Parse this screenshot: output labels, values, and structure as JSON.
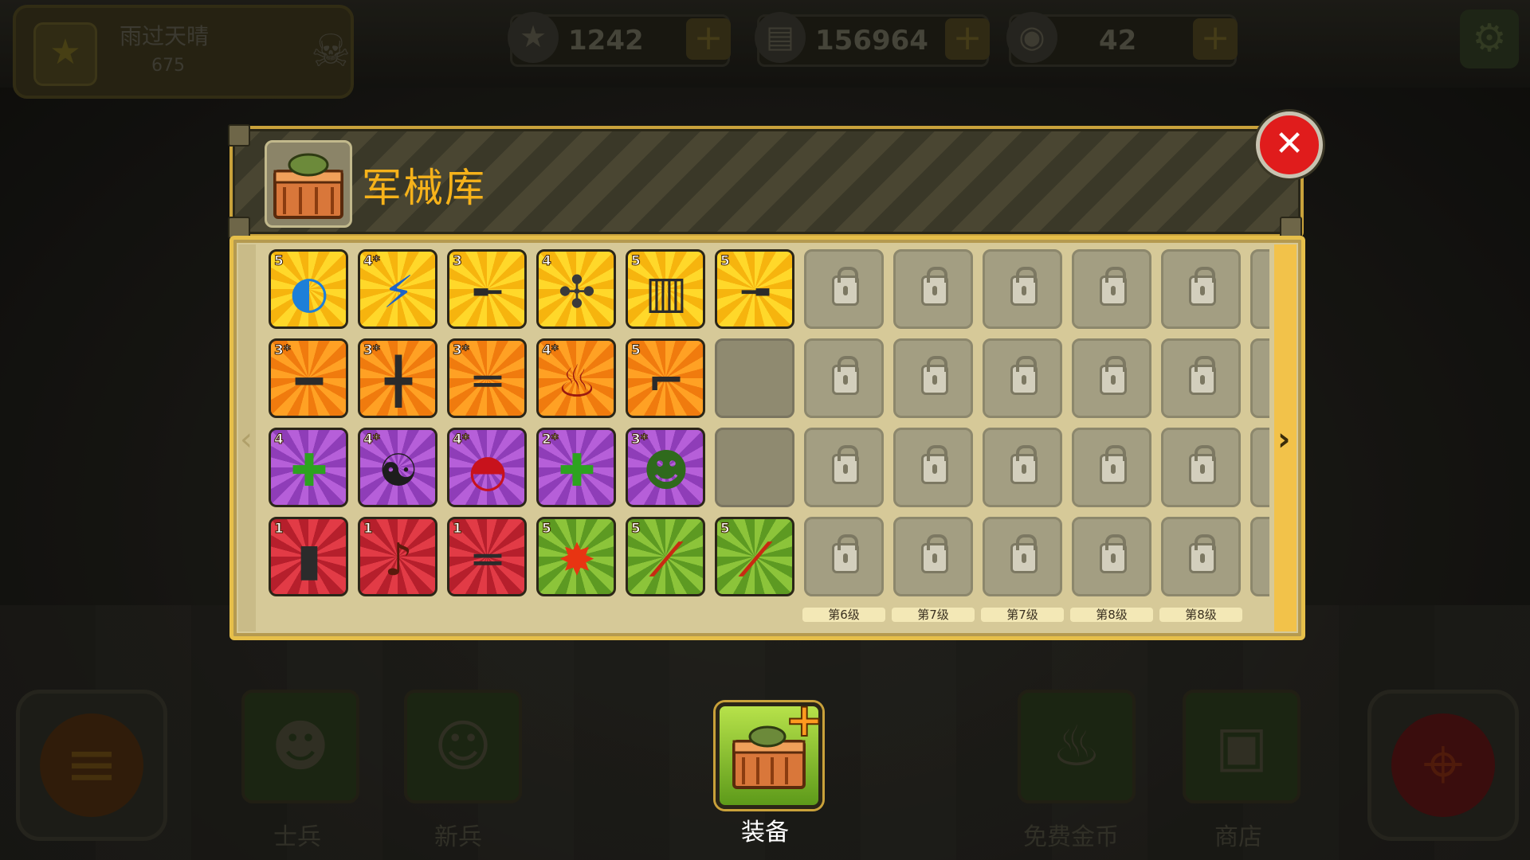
{
  "player": {
    "name": "雨过天晴",
    "medals": "675"
  },
  "resources": [
    {
      "name": "stars",
      "icon": "star-icon",
      "value": "1242"
    },
    {
      "name": "cash",
      "icon": "cash-icon",
      "value": "156964"
    },
    {
      "name": "coins",
      "icon": "coin-icon",
      "value": "42"
    }
  ],
  "armory": {
    "title": "军械库"
  },
  "items": [
    {
      "row": 0,
      "col": 0,
      "level": "5",
      "bg": "yellow",
      "icon": "shield-soldier-icon"
    },
    {
      "row": 0,
      "col": 1,
      "level": "4*",
      "bg": "yellow",
      "icon": "blue-lightning-gun-icon"
    },
    {
      "row": 0,
      "col": 2,
      "level": "3",
      "bg": "yellow",
      "icon": "rifle-icon"
    },
    {
      "row": 0,
      "col": 3,
      "level": "4",
      "bg": "yellow",
      "icon": "drone-icon"
    },
    {
      "row": 0,
      "col": 4,
      "level": "5",
      "bg": "yellow",
      "icon": "gatling-icon"
    },
    {
      "row": 0,
      "col": 5,
      "level": "5",
      "bg": "yellow",
      "icon": "assault-rifle-icon"
    },
    {
      "row": 1,
      "col": 0,
      "level": "3*",
      "bg": "orange",
      "icon": "sniper-rifle-icon"
    },
    {
      "row": 1,
      "col": 1,
      "level": "3*",
      "bg": "orange",
      "icon": "machine-gun-icon"
    },
    {
      "row": 1,
      "col": 2,
      "level": "3*",
      "bg": "orange",
      "icon": "shotgun-icon"
    },
    {
      "row": 1,
      "col": 3,
      "level": "4*",
      "bg": "orange",
      "icon": "molotov-icon"
    },
    {
      "row": 1,
      "col": 4,
      "level": "5",
      "bg": "orange",
      "icon": "flare-pistol-icon"
    },
    {
      "row": 2,
      "col": 0,
      "level": "4",
      "bg": "purple",
      "icon": "green-flame-plus-icon"
    },
    {
      "row": 2,
      "col": 1,
      "level": "4*",
      "bg": "purple",
      "icon": "yin-yang-icon"
    },
    {
      "row": 2,
      "col": 2,
      "level": "4*",
      "bg": "purple",
      "icon": "red-helmet-icon"
    },
    {
      "row": 2,
      "col": 3,
      "level": "2*",
      "bg": "purple",
      "icon": "green-flame-plus-icon"
    },
    {
      "row": 2,
      "col": 4,
      "level": "3*",
      "bg": "purple",
      "icon": "soldier-hat-icon"
    },
    {
      "row": 3,
      "col": 0,
      "level": "1",
      "bg": "red",
      "icon": "battery-launcher-icon"
    },
    {
      "row": 3,
      "col": 1,
      "level": "1",
      "bg": "red",
      "icon": "guitar-icon"
    },
    {
      "row": 3,
      "col": 2,
      "level": "1",
      "bg": "red",
      "icon": "pump-shotgun-icon"
    },
    {
      "row": 3,
      "col": 3,
      "level": "5",
      "bg": "green",
      "icon": "explosion-plus-icon"
    },
    {
      "row": 3,
      "col": 4,
      "level": "5",
      "bg": "green",
      "icon": "laser-mine-icon"
    },
    {
      "row": 3,
      "col": 5,
      "level": "5",
      "bg": "green",
      "icon": "laser-mine-icon"
    }
  ],
  "empty_slots": [
    {
      "row": 1,
      "col": 5
    },
    {
      "row": 2,
      "col": 5
    }
  ],
  "locked_columns": [
    {
      "col": 6,
      "requirement": "第6级"
    },
    {
      "col": 7,
      "requirement": "第7级"
    },
    {
      "col": 8,
      "requirement": "第7级"
    },
    {
      "col": 9,
      "requirement": "第8级"
    },
    {
      "col": 10,
      "requirement": "第8级"
    }
  ],
  "nav": {
    "soldiers": "士兵",
    "recruits": "新兵",
    "equipment": "装备",
    "free_coins": "免费金币",
    "shop": "商店"
  }
}
